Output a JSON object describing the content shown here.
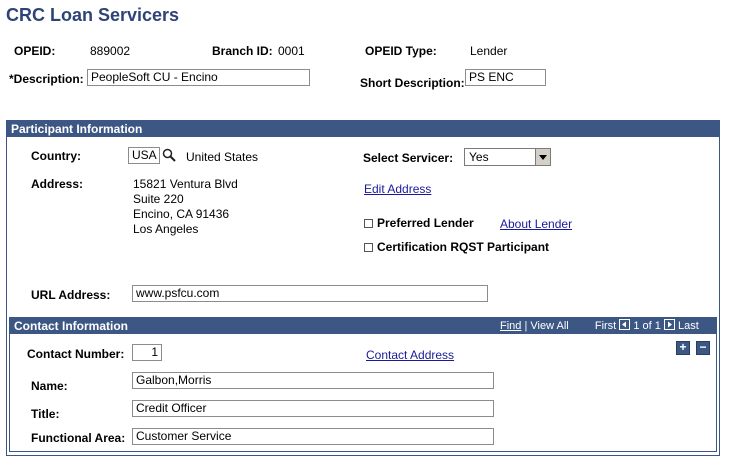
{
  "page": {
    "title": "CRC Loan Servicers"
  },
  "header": {
    "opeid_label": "OPEID:",
    "opeid_value": "889002",
    "branch_label": "Branch ID:",
    "branch_value": "0001",
    "opeid_type_label": "OPEID Type:",
    "opeid_type_value": "Lender",
    "description_label": "*Description:",
    "description_value": "PeopleSoft CU - Encino",
    "short_description_label": "Short Description:",
    "short_description_value": "PS ENC"
  },
  "participant": {
    "section_title": "Participant Information",
    "country_label": "Country:",
    "country_code": "USA",
    "country_name": "United States",
    "select_servicer_label": "Select Servicer:",
    "select_servicer_value": "Yes",
    "address_label": "Address:",
    "address_lines": [
      "15821 Ventura Blvd",
      "Suite 220",
      "Encino, CA 91436",
      "Los Angeles"
    ],
    "edit_address_link": "Edit Address",
    "preferred_lender_label": "Preferred Lender",
    "about_lender_link": "About Lender",
    "certification_label": "Certification RQST Participant",
    "url_label": "URL Address:",
    "url_value": "www.psfcu.com"
  },
  "contact": {
    "section_title": "Contact Information",
    "nav": {
      "find": "Find",
      "view_all": "View All",
      "first": "First",
      "count": "1 of 1",
      "last": "Last",
      "separator": "|"
    },
    "contact_number_label": "Contact Number:",
    "contact_number_value": "1",
    "contact_address_link": "Contact Address",
    "name_label": "Name:",
    "name_value": "Galbon,Morris",
    "title_label": "Title:",
    "title_value": "Credit Officer",
    "functional_area_label": "Functional Area:",
    "functional_area_value": "Customer Service",
    "add_symbol": "+",
    "remove_symbol": "−"
  },
  "icons": {
    "lookup": "magnifier-icon",
    "prev": "arrow-left-icon",
    "next": "arrow-right-icon"
  },
  "colors": {
    "accent": "#3d5785",
    "title": "#2e4477",
    "link": "#1a1a9a"
  }
}
